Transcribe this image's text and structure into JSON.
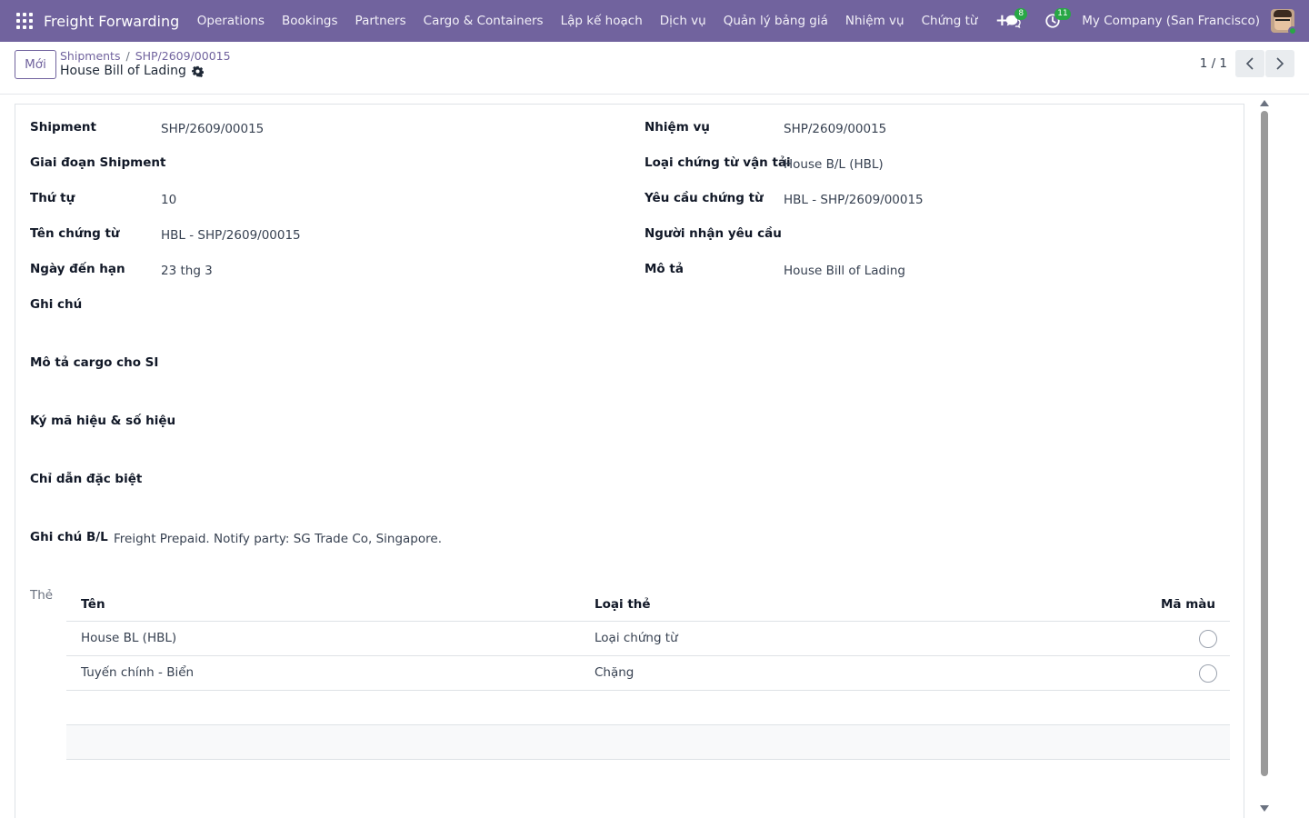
{
  "navbar": {
    "brand": "Freight Forwarding",
    "menu": [
      "Operations",
      "Bookings",
      "Partners",
      "Cargo & Containers",
      "Lập kế hoạch",
      "Dịch vụ",
      "Quản lý bảng giá",
      "Nhiệm vụ",
      "Chứng từ"
    ],
    "messages_badge": "8",
    "activities_badge": "11",
    "company": "My Company (San Francisco)",
    "bg_color": "#71639e",
    "icons": [
      "apps-icon",
      "plus-icon",
      "chat-icon",
      "clock-icon",
      "avatar"
    ]
  },
  "control_panel": {
    "new_button": "Mới",
    "breadcrumb": [
      "Shipments",
      "SHP/2609/00015"
    ],
    "breadcrumb_sep": "/",
    "title": "House Bill of Lading",
    "pager": "1 / 1"
  },
  "form": {
    "left": [
      {
        "label": "Shipment",
        "value": "SHP/2609/00015"
      },
      {
        "label": "Giai đoạn Shipment",
        "value": ""
      },
      {
        "label": "Thứ tự",
        "value": "10"
      },
      {
        "label": "Tên chứng từ",
        "value": "HBL - SHP/2609/00015"
      },
      {
        "label": "Ngày đến hạn",
        "value": "23 thg 3"
      },
      {
        "label": "Ghi chú",
        "value": ""
      }
    ],
    "right": [
      {
        "label": "Nhiệm vụ",
        "value": "SHP/2609/00015"
      },
      {
        "label": "Loại chứng từ vận tải",
        "value": "House B/L (HBL)"
      },
      {
        "label": "Yêu cầu chứng từ",
        "value": "HBL - SHP/2609/00015"
      },
      {
        "label": "Người nhận yêu cầu",
        "value": ""
      },
      {
        "label": "Mô tả",
        "value": "House Bill of Lading"
      }
    ],
    "full": [
      {
        "label": "Mô tả cargo cho SI",
        "value": ""
      },
      {
        "label": "Ký mã hiệu & số hiệu",
        "value": ""
      },
      {
        "label": "Chỉ dẫn đặc biệt",
        "value": ""
      },
      {
        "label": "Ghi chú B/L",
        "value": "Freight Prepaid. Notify party: SG Trade Co, Singapore."
      }
    ],
    "tags_label": "Thẻ"
  },
  "tags_table": {
    "columns": [
      "Tên",
      "Loại thẻ",
      "Mã màu"
    ],
    "rows": [
      {
        "name": "House BL (HBL)",
        "type": "Loại chứng từ"
      },
      {
        "name": "Tuyến chính - Biển",
        "type": "Chặng"
      }
    ]
  }
}
